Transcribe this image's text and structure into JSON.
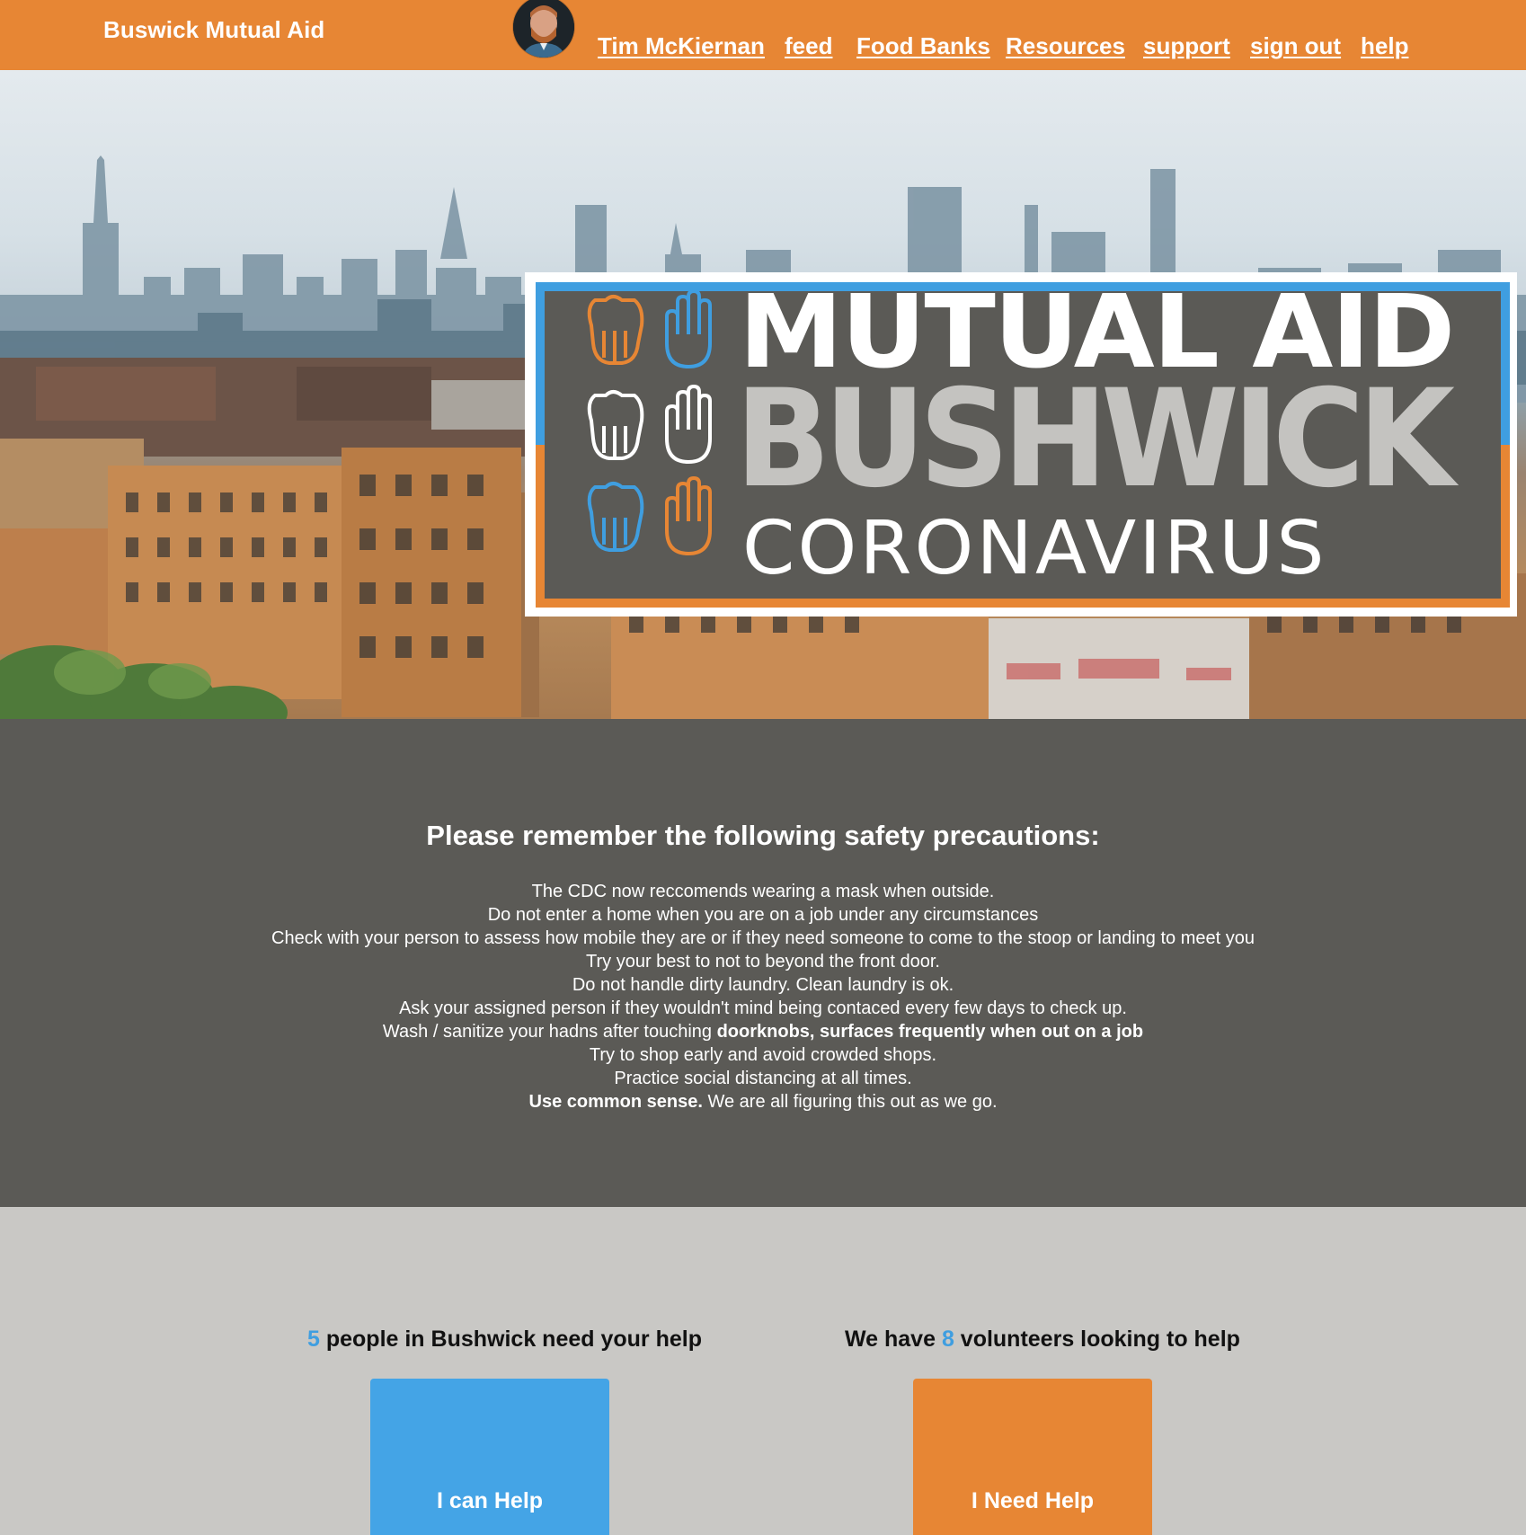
{
  "navbar": {
    "brand": "Buswick Mutual Aid",
    "user_name": "Tim McKiernan",
    "links": [
      "feed",
      "Food Banks",
      "Resources",
      "support",
      "sign out",
      "help"
    ]
  },
  "hero": {
    "logo": {
      "line1": "MUTUAL AID",
      "line2": "BUSHWICK",
      "line3": "CORONAVIRUS"
    }
  },
  "safety": {
    "heading": "Please remember the following safety precautions:",
    "rules": [
      {
        "pre": "The CDC now reccomends wearing a mask when outside.",
        "bold": "",
        "post": ""
      },
      {
        "pre": "Do not enter a home when you are on a job under any circumstances",
        "bold": "",
        "post": ""
      },
      {
        "pre": "Check with your person to assess how mobile they are or if they need someone to come to the stoop or landing to meet you",
        "bold": "",
        "post": ""
      },
      {
        "pre": "Try your best to not to beyond the front door.",
        "bold": "",
        "post": ""
      },
      {
        "pre": "Do not handle dirty laundry. Clean laundry is ok.",
        "bold": "",
        "post": ""
      },
      {
        "pre": "Ask your assigned person if they wouldn't mind being contaced every few days to check up.",
        "bold": "",
        "post": ""
      },
      {
        "pre": "Wash / sanitize your hadns after touching ",
        "bold": "doorknobs, surfaces frequently when out on a job",
        "post": ""
      },
      {
        "pre": "Try to shop early and avoid crowded shops.",
        "bold": "",
        "post": ""
      },
      {
        "pre": "Practice social distancing at all times.",
        "bold": "",
        "post": ""
      },
      {
        "pre": "",
        "bold": "Use common sense.",
        "post": " We are all figuring this out as we go."
      }
    ]
  },
  "stats": {
    "need_count": "5",
    "need_text": " people in Bushwick need your help",
    "volunteer_prefix": "We have ",
    "volunteer_count": "8",
    "volunteer_suffix": " volunteers looking to help",
    "can_help_label": "I can Help",
    "need_help_label": "I Need Help"
  },
  "colors": {
    "orange": "#e78634",
    "blue": "#44a4e6",
    "dark_gray": "#5b5a56",
    "light_gray": "#c9c8c5"
  }
}
